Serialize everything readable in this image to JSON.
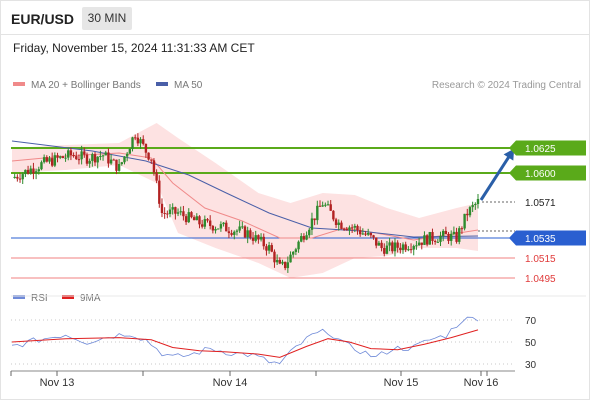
{
  "header": {
    "symbol": "EUR/USD",
    "timeframe": "30 MIN",
    "datetime": "Friday, November 15, 2024 11:31:33 AM CET"
  },
  "legend": {
    "ma20_label": "MA 20 + Bollinger Bands",
    "ma50_label": "MA 50",
    "credit": "Research © 2024 Trading Central",
    "rsi_label": "RSI",
    "ma9_label": "9MA"
  },
  "colors": {
    "up_candle": "#2e8b2e",
    "down_candle": "#b22222",
    "bollinger_fill": "#fde2e2",
    "ma20": "#f08a8a",
    "ma50": "#4a5fa8",
    "resistance": "#5aaa1a",
    "pivot": "#2a5fd0",
    "support": "#f08080",
    "arrow": "#2a5fa8",
    "rsi_line": "#6f8ad8",
    "rsi_ma": "#e02020"
  },
  "chart_data": [
    {
      "type": "candlestick",
      "title": "",
      "x_labels": [
        "Nov 13",
        "Nov 14",
        "Nov 15",
        "Nov 16"
      ],
      "ylim": [
        1.0483,
        1.0673
      ],
      "levels": [
        {
          "value": 1.0625,
          "label": "1.0625",
          "kind": "resistance"
        },
        {
          "value": 1.06,
          "label": "1.0600",
          "kind": "resistance"
        },
        {
          "value": 1.0571,
          "label": "1.0571",
          "kind": "current"
        },
        {
          "value": 1.0535,
          "label": "1.0535",
          "kind": "pivot"
        },
        {
          "value": 1.0515,
          "label": "1.0515",
          "kind": "support"
        },
        {
          "value": 1.0495,
          "label": "1.0495",
          "kind": "support"
        }
      ],
      "price_path": [
        [
          0,
          1.0595
        ],
        [
          12,
          1.061
        ],
        [
          22,
          1.0618
        ],
        [
          28,
          1.0615
        ],
        [
          34,
          1.0618
        ],
        [
          40,
          1.0605
        ],
        [
          46,
          1.064
        ],
        [
          50,
          1.0622
        ],
        [
          52,
          1.0615
        ],
        [
          56,
          1.056
        ],
        [
          62,
          1.056
        ],
        [
          70,
          1.055
        ],
        [
          80,
          1.0545
        ],
        [
          88,
          1.054
        ],
        [
          96,
          1.0525
        ],
        [
          100,
          1.0505
        ],
        [
          102,
          1.0508
        ],
        [
          108,
          1.0535
        ],
        [
          116,
          1.057
        ],
        [
          122,
          1.055
        ],
        [
          128,
          1.0545
        ],
        [
          134,
          1.0535
        ],
        [
          138,
          1.0525
        ],
        [
          142,
          1.0525
        ],
        [
          150,
          1.053
        ],
        [
          156,
          1.0535
        ],
        [
          162,
          1.0537
        ],
        [
          166,
          1.0535
        ],
        [
          170,
          1.056
        ],
        [
          174,
          1.0571
        ]
      ],
      "ma50_path": [
        [
          0,
          1.0632
        ],
        [
          30,
          1.0622
        ],
        [
          50,
          1.0612
        ],
        [
          66,
          1.0598
        ],
        [
          80,
          1.058
        ],
        [
          96,
          1.056
        ],
        [
          112,
          1.0545
        ],
        [
          130,
          1.0542
        ],
        [
          150,
          1.0536
        ],
        [
          174,
          1.0537
        ]
      ],
      "ma20_path": [
        [
          0,
          1.0612
        ],
        [
          20,
          1.0617
        ],
        [
          40,
          1.062
        ],
        [
          52,
          1.0615
        ],
        [
          60,
          1.059
        ],
        [
          72,
          1.0565
        ],
        [
          86,
          1.0552
        ],
        [
          100,
          1.0535
        ],
        [
          112,
          1.0535
        ],
        [
          124,
          1.0545
        ],
        [
          136,
          1.054
        ],
        [
          150,
          1.0533
        ],
        [
          174,
          1.0543
        ]
      ],
      "bollinger_upper": [
        [
          0,
          1.0625
        ],
        [
          20,
          1.0628
        ],
        [
          40,
          1.063
        ],
        [
          54,
          1.065
        ],
        [
          62,
          1.0635
        ],
        [
          76,
          1.061
        ],
        [
          92,
          1.058
        ],
        [
          104,
          1.057
        ],
        [
          116,
          1.058
        ],
        [
          128,
          1.0578
        ],
        [
          140,
          1.0565
        ],
        [
          152,
          1.0555
        ],
        [
          166,
          1.0565
        ],
        [
          174,
          1.057
        ]
      ],
      "bollinger_lower": [
        [
          0,
          1.06
        ],
        [
          20,
          1.0603
        ],
        [
          40,
          1.0608
        ],
        [
          54,
          1.059
        ],
        [
          62,
          1.054
        ],
        [
          76,
          1.0525
        ],
        [
          92,
          1.051
        ],
        [
          104,
          1.0495
        ],
        [
          116,
          1.05
        ],
        [
          128,
          1.0515
        ],
        [
          140,
          1.0517
        ],
        [
          152,
          1.0525
        ],
        [
          166,
          1.0525
        ],
        [
          174,
          1.0522
        ]
      ],
      "projection": {
        "from": 1.0571,
        "to": 1.0625
      }
    },
    {
      "type": "line",
      "title": "RSI",
      "ylim": [
        20,
        80
      ],
      "y_ticks": [
        70,
        50,
        30
      ],
      "series": [
        {
          "name": "RSI",
          "points": [
            [
              0,
              46
            ],
            [
              10,
              52
            ],
            [
              20,
              57
            ],
            [
              28,
              50
            ],
            [
              36,
              55
            ],
            [
              44,
              58
            ],
            [
              50,
              52
            ],
            [
              56,
              40
            ],
            [
              60,
              36
            ],
            [
              66,
              38
            ],
            [
              74,
              44
            ],
            [
              82,
              40
            ],
            [
              90,
              38
            ],
            [
              96,
              32
            ],
            [
              100,
              30
            ],
            [
              106,
              45
            ],
            [
              112,
              56
            ],
            [
              118,
              60
            ],
            [
              124,
              48
            ],
            [
              130,
              42
            ],
            [
              136,
              36
            ],
            [
              142,
              44
            ],
            [
              150,
              45
            ],
            [
              156,
              52
            ],
            [
              162,
              56
            ],
            [
              168,
              70
            ],
            [
              174,
              72
            ]
          ]
        },
        {
          "name": "9MA",
          "points": [
            [
              0,
              50
            ],
            [
              20,
              53
            ],
            [
              40,
              54
            ],
            [
              52,
              52
            ],
            [
              60,
              45
            ],
            [
              70,
              42
            ],
            [
              80,
              41
            ],
            [
              92,
              39
            ],
            [
              100,
              36
            ],
            [
              110,
              46
            ],
            [
              118,
              53
            ],
            [
              126,
              50
            ],
            [
              134,
              44
            ],
            [
              144,
              43
            ],
            [
              154,
              48
            ],
            [
              164,
              54
            ],
            [
              174,
              61
            ]
          ]
        }
      ]
    }
  ]
}
